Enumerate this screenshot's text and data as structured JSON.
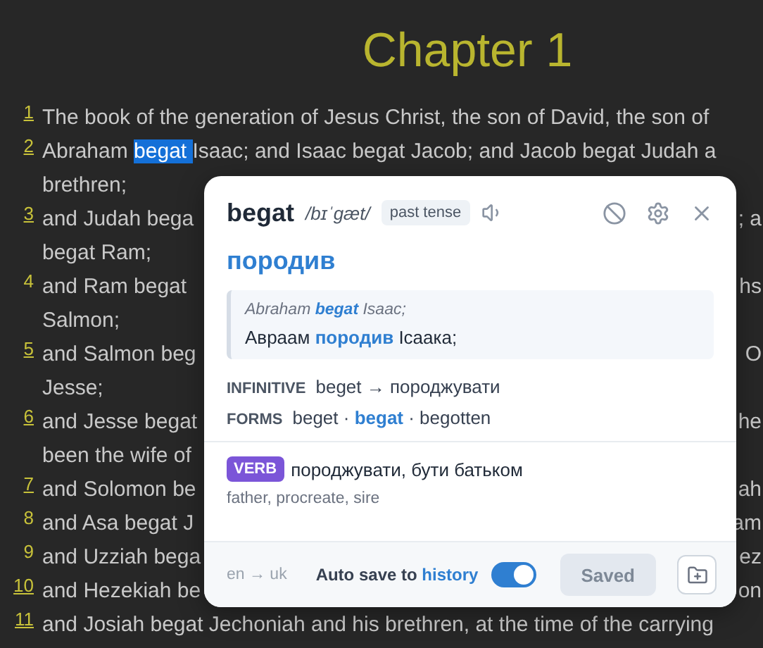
{
  "chapter_title": "Chapter 1",
  "verses": [
    {
      "number": "1",
      "underlined": true,
      "lines": [
        {
          "segments": [
            {
              "text": "The book of the generation of Jesus Christ, the son of David, the son of",
              "selected": false
            }
          ]
        }
      ]
    },
    {
      "number": "2",
      "underlined": true,
      "lines": [
        {
          "segments": [
            {
              "text": "Abraham ",
              "selected": false
            },
            {
              "text": "begat ",
              "selected": true
            },
            {
              "text": "Isaac; and Isaac begat Jacob; and Jacob begat Judah a",
              "selected": false
            }
          ]
        },
        {
          "segments": [
            {
              "text": "brethren;",
              "selected": false
            }
          ]
        }
      ]
    },
    {
      "number": "3",
      "underlined": true,
      "lines": [
        {
          "segments": [
            {
              "text": "and Judah bega",
              "selected": false
            }
          ],
          "tail": "; a"
        },
        {
          "segments": [
            {
              "text": "begat Ram;",
              "selected": false
            }
          ]
        }
      ]
    },
    {
      "number": "4",
      "underlined": false,
      "lines": [
        {
          "segments": [
            {
              "text": "and Ram begat",
              "selected": false
            }
          ],
          "tail": "hs"
        },
        {
          "segments": [
            {
              "text": "Salmon;",
              "selected": false
            }
          ]
        }
      ]
    },
    {
      "number": "5",
      "underlined": true,
      "lines": [
        {
          "segments": [
            {
              "text": "and Salmon beg",
              "selected": false
            }
          ],
          "tail": "O"
        },
        {
          "segments": [
            {
              "text": "Jesse;",
              "selected": false
            }
          ]
        }
      ]
    },
    {
      "number": "6",
      "underlined": true,
      "lines": [
        {
          "segments": [
            {
              "text": "and Jesse begat",
              "selected": false
            }
          ],
          "tail": "he"
        },
        {
          "segments": [
            {
              "text": "been the wife of",
              "selected": false
            }
          ]
        }
      ]
    },
    {
      "number": "7",
      "underlined": true,
      "lines": [
        {
          "segments": [
            {
              "text": "and Solomon be",
              "selected": false
            }
          ],
          "tail": "ah"
        }
      ]
    },
    {
      "number": "8",
      "underlined": false,
      "lines": [
        {
          "segments": [
            {
              "text": "and Asa begat J",
              "selected": false
            }
          ],
          "tail": "am"
        }
      ]
    },
    {
      "number": "9",
      "underlined": false,
      "lines": [
        {
          "segments": [
            {
              "text": "and Uzziah bega",
              "selected": false
            }
          ],
          "tail": "ez"
        }
      ]
    },
    {
      "number": "10",
      "underlined": true,
      "lines": [
        {
          "segments": [
            {
              "text": "and Hezekiah be",
              "selected": false
            }
          ],
          "tail": "on"
        }
      ]
    },
    {
      "number": "11",
      "underlined": true,
      "lines": [
        {
          "segments": [
            {
              "text": "and Josiah begat Jechoniah and his brethren, at the time of the carrying",
              "selected": false
            }
          ]
        }
      ]
    }
  ],
  "popup": {
    "word": "begat",
    "phonetic": "/bɪˈɡæt/",
    "tag": "past tense",
    "translation": "породив",
    "example": {
      "source": "Abraham **begat** Isaac;",
      "target": "Авраам **породив** Ісаака;"
    },
    "grammar": [
      {
        "label": "INFINITIVE",
        "value": "beget → породжувати"
      },
      {
        "label": "FORMS",
        "value": "beget · **begat** · begotten"
      }
    ],
    "senses": [
      {
        "pos": "VERB",
        "meaning": "породжувати, бути батьком",
        "synonyms": "father, procreate, sire"
      }
    ],
    "footer": {
      "language_pair": "en → uk",
      "autosave_label": "Auto save to **history**",
      "autosave_on": true,
      "save_button": "Saved",
      "save_disabled": true
    }
  }
}
